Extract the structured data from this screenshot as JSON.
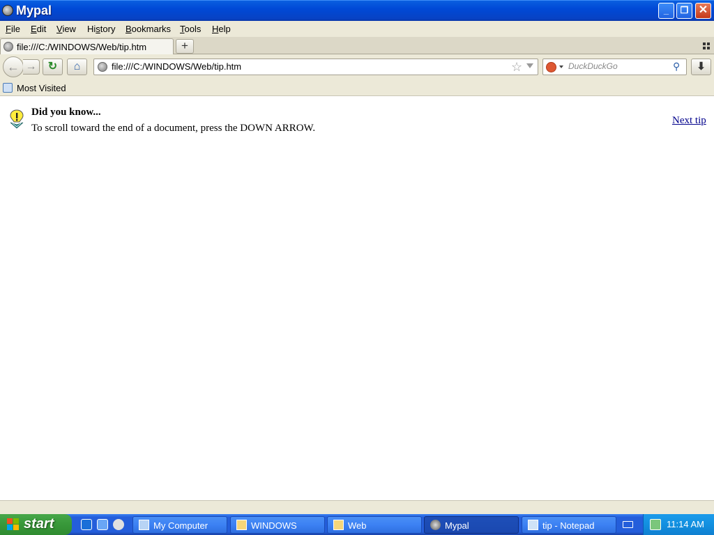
{
  "window": {
    "title": "Mypal",
    "minimize": "_",
    "maximize": "❐",
    "close": "✕"
  },
  "menu": {
    "items": [
      {
        "pre": "",
        "ul": "F",
        "post": "ile"
      },
      {
        "pre": "",
        "ul": "E",
        "post": "dit"
      },
      {
        "pre": "",
        "ul": "V",
        "post": "iew"
      },
      {
        "pre": "Hi",
        "ul": "s",
        "post": "tory"
      },
      {
        "pre": "",
        "ul": "B",
        "post": "ookmarks"
      },
      {
        "pre": "",
        "ul": "T",
        "post": "ools"
      },
      {
        "pre": "",
        "ul": "H",
        "post": "elp"
      }
    ]
  },
  "tabs": {
    "active_label": "file:///C:/WINDOWS/Web/tip.htm",
    "new_tab": "+"
  },
  "nav": {
    "back": "←",
    "forward": "→",
    "reload": "↻",
    "home": "⌂",
    "url": "file:///C:/WINDOWS/Web/tip.htm",
    "star": "☆",
    "search_placeholder": "DuckDuckGo",
    "search_go": "⚲",
    "download": "⬇"
  },
  "bookmarks": {
    "most_visited": "Most Visited"
  },
  "content": {
    "heading": "Did you know...",
    "tip": "To scroll toward the end of a document, press the DOWN ARROW.",
    "next_tip": "Next tip"
  },
  "taskbar": {
    "start": "start",
    "tasks": [
      {
        "label": "My Computer",
        "icon": "computer-icon"
      },
      {
        "label": "WINDOWS",
        "icon": "folder-icon"
      },
      {
        "label": "Web",
        "icon": "folder-icon"
      },
      {
        "label": "Mypal",
        "icon": "mypal-icon",
        "active": true
      },
      {
        "label": "tip - Notepad",
        "icon": "notepad-icon"
      }
    ],
    "clock": "11:14 AM"
  },
  "colors": {
    "titlebar": "#0049d6",
    "chrome": "#ece9d8",
    "taskbar": "#245edb",
    "start": "#3a9a3c",
    "link": "#00008b"
  }
}
